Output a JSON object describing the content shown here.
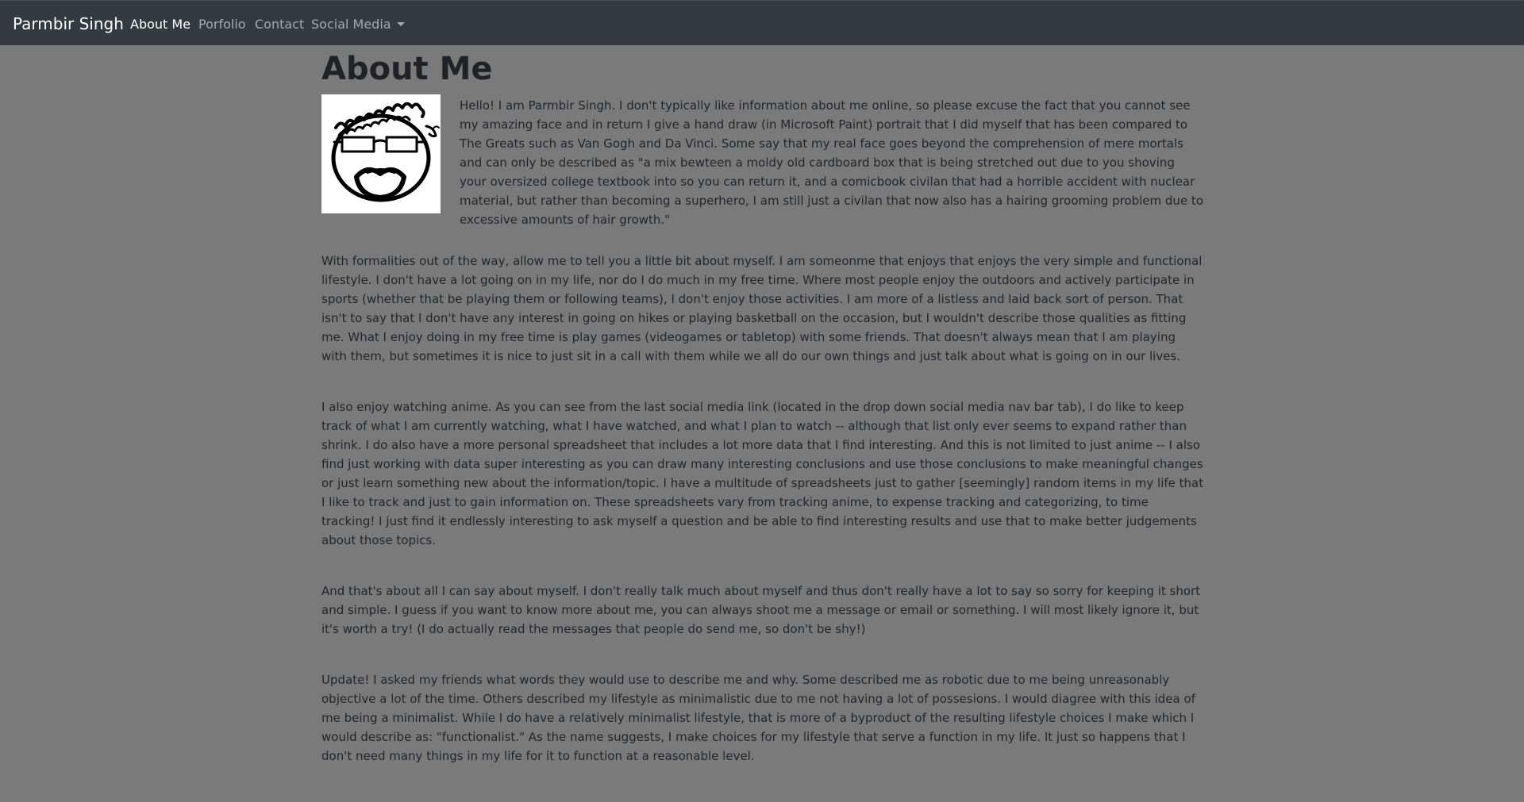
{
  "navbar": {
    "brand": "Parmbir Singh",
    "items": [
      {
        "label": "About Me",
        "active": true
      },
      {
        "label": "Porfolio",
        "active": false
      },
      {
        "label": "Contact",
        "active": false
      },
      {
        "label": "Social Media",
        "active": false,
        "dropdown": true
      }
    ]
  },
  "main": {
    "title": "About Me",
    "avatar_icon": "hand-drawn-portrait",
    "paragraphs": [
      "Hello! I am Parmbir Singh. I don't typically like information about me online, so please excuse the fact that you cannot see my amazing face and in return I give a hand draw (in Microsoft Paint) portrait that I did myself that has been compared to The Greats such as Van Gogh and Da Vinci. Some say that my real face goes beyond the comprehension of mere mortals and can only be described as \"a mix bewteen a moldy old cardboard box that is being stretched out due to you shoving your oversized college textbook into so you can return it, and a comicbook civilan that had a horrible accident with nuclear material, but rather than becoming a superhero, I am still just a civilan that now also has a hairing grooming problem due to excessive amounts of hair growth.\"",
      "With formalities out of the way, allow me to tell you a little bit about myself. I am someonme that enjoys that enjoys the very simple and functional lifestyle. I don't have a lot going on in my life, nor do I do much in my free time. Where most people enjoy the outdoors and actively participate in sports (whether that be playing them or following teams), I don't enjoy those activities. I am more of a listless and laid back sort of person. That isn't to say that I don't have any interest in going on hikes or playing basketball on the occasion, but I wouldn't describe those qualities as fitting me. What I enjoy doing in my free time is play games (videogames or tabletop) with some friends. That doesn't always mean that I am playing with them, but sometimes it is nice to just sit in a call with them while we all do our own things and just talk about what is going on in our lives.",
      "I also enjoy watching anime. As you can see from the last social media link (located in the drop down social media nav bar tab), I do like to keep track of what I am currently watching, what I have watched, and what I plan to watch -- although that list only ever seems to expand rather than shrink. I do also have a more personal spreadsheet that includes a lot more data that I find interesting. And this is not limited to just anime -- I also find just working with data super interesting as you can draw many interesting conclusions and use those conclusions to make meaningful changes or just learn something new about the information/topic. I have a multitude of spreadsheets just to gather [seemingly] random items in my life that I like to track and just to gain information on. These spreadsheets vary from tracking anime, to expense tracking and categorizing, to time tracking! I just find it endlessly interesting to ask myself a question and be able to find interesting results and use that to make better judgements about those topics.",
      "And that's about all I can say about myself. I don't really talk much about myself and thus don't really have a lot to say so sorry for keeping it short and simple. I guess if you want to know more about me, you can always shoot me a message or email or something. I will most likely ignore it, but it's worth a try! (I do actually read the messages that people do send me, so don't be shy!)",
      "Update! I asked my friends what words they would use to describe me and why. Some described me as robotic due to me being unreasonably objective a lot of the time. Others described my lifestyle as minimalistic due to me not having a lot of possesions. I would diagree with this idea of me being a minimalist. While I do have a relatively minimalist lifestyle, that is more of a byproduct of the resulting lifestyle choices I make which I would describe as: \"functionalist.\" As the name suggests, I make choices for my lifestyle that serve a function in my life. It just so happens that I don't need many things in my life for it to function at a reasonable level."
    ]
  }
}
